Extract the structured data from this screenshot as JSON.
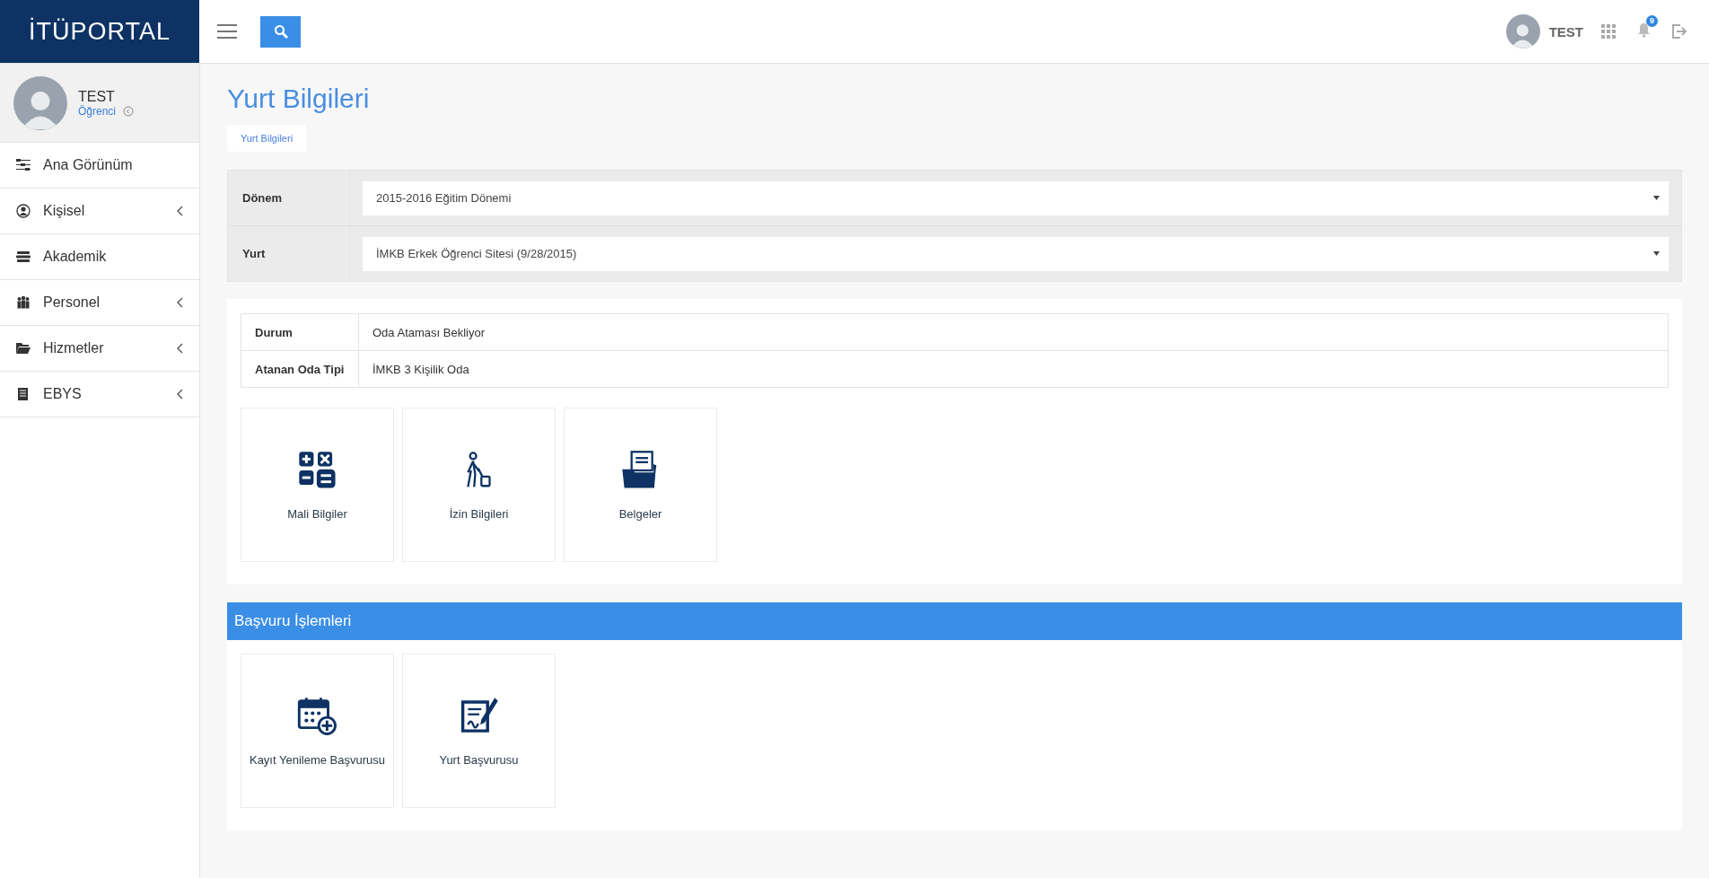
{
  "header": {
    "logo": "İTÜPORTAL",
    "user_name": "TEST",
    "notification_count": "9"
  },
  "profile": {
    "name": "TEST",
    "role": "Öğrenci"
  },
  "sidebar": {
    "items": [
      {
        "label": "Ana Görünüm",
        "submenu": false
      },
      {
        "label": "Kişisel",
        "submenu": true
      },
      {
        "label": "Akademik",
        "submenu": false
      },
      {
        "label": "Personel",
        "submenu": true
      },
      {
        "label": "Hizmetler",
        "submenu": true
      },
      {
        "label": "EBYS",
        "submenu": true
      }
    ]
  },
  "page": {
    "title": "Yurt Bilgileri",
    "tabs": [
      {
        "label": "Yurt Bilgileri",
        "selected": true
      }
    ]
  },
  "filters": [
    {
      "label": "Dönem",
      "value": "2015-2016 Eğitim Dönemi"
    },
    {
      "label": "Yurt",
      "value": "İMKB Erkek Öğrenci Sitesi (9/28/2015)"
    }
  ],
  "details": [
    {
      "label": "Durum",
      "value": "Oda Ataması Bekliyor"
    },
    {
      "label": "Atanan Oda Tipi",
      "value": "İMKB 3 Kişilik Oda"
    }
  ],
  "tiles": [
    {
      "label": "Mali Bilgiler"
    },
    {
      "label": "İzin Bilgileri"
    },
    {
      "label": "Belgeler"
    }
  ],
  "application_section": {
    "title": "Başvuru İşlemleri",
    "tiles": [
      {
        "label": "Kayıt Yenileme Başvurusu"
      },
      {
        "label": "Yurt Başvurusu"
      }
    ]
  }
}
